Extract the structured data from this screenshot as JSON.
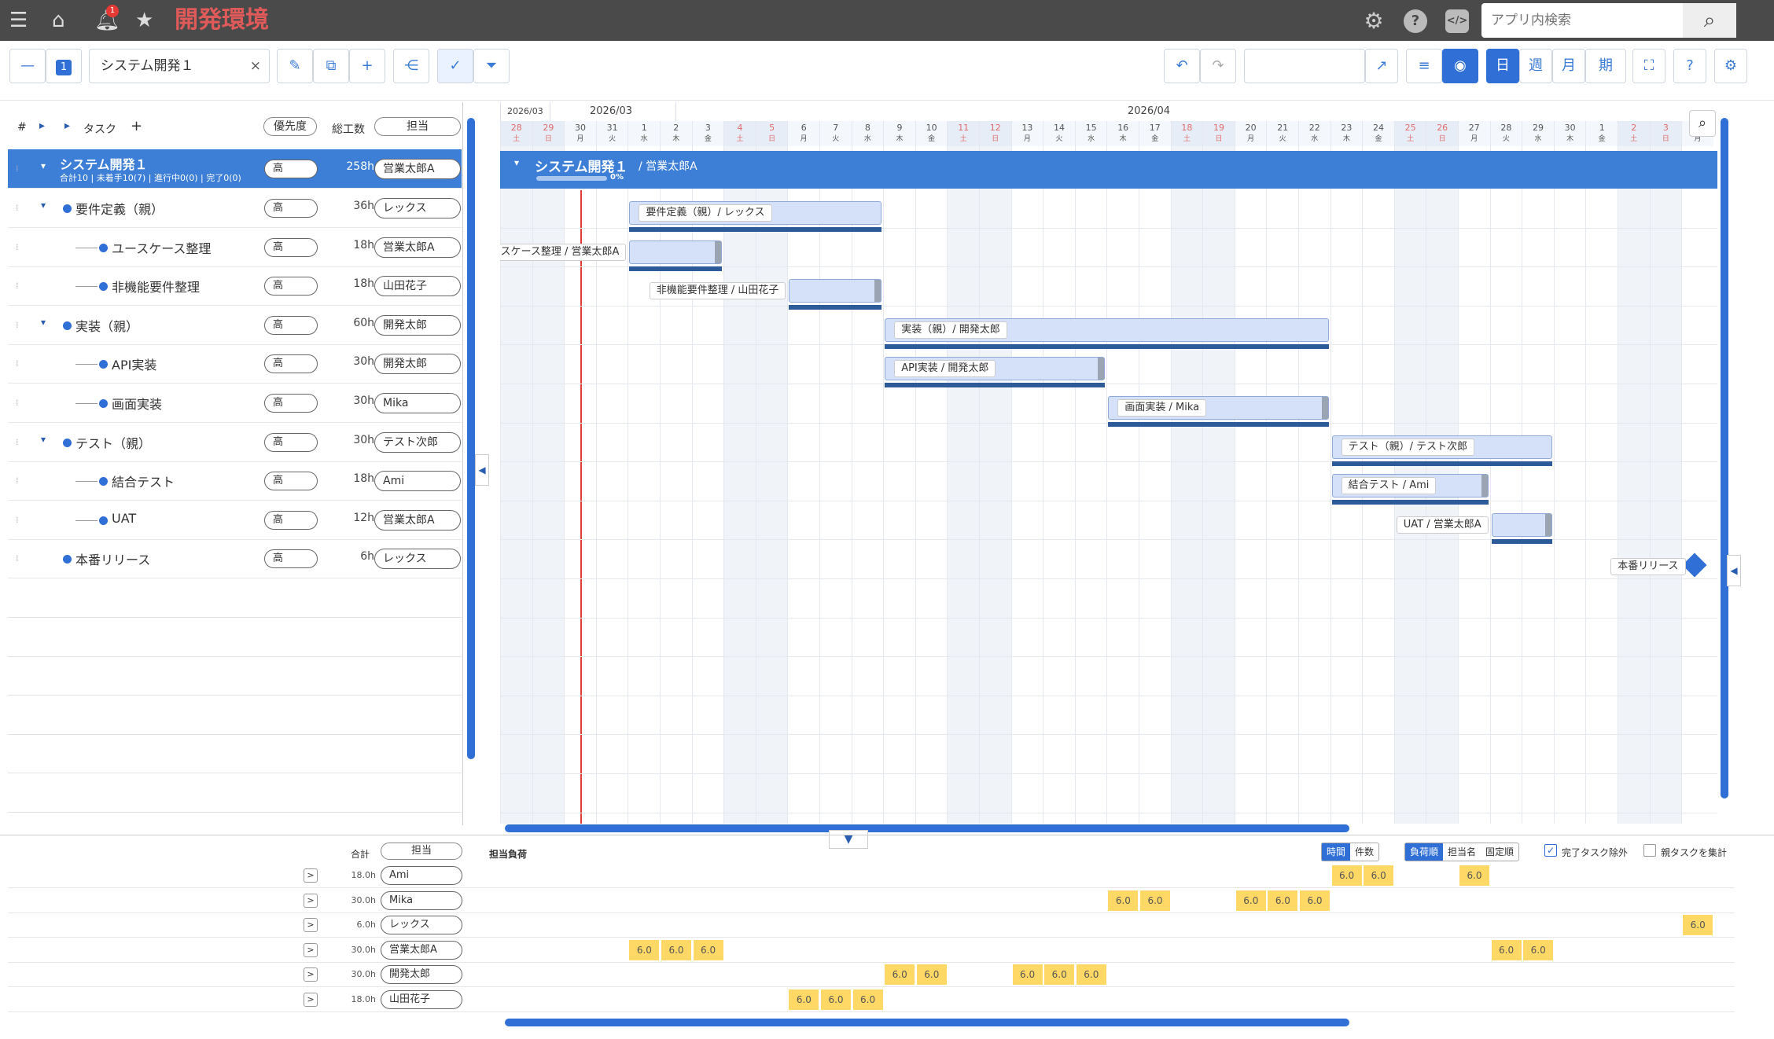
{
  "app": {
    "title": "開発環境",
    "notif_count": "1",
    "search_placeholder": "アプリ内検索"
  },
  "toolbar": {
    "layer_badge": "1",
    "project_name": "システム開発１",
    "clear": "×",
    "view_buttons": [
      "日",
      "週",
      "月",
      "期"
    ],
    "active_view": "日"
  },
  "grid": {
    "headers": {
      "num": "#",
      "task": "タスク",
      "add": "+",
      "priority": "優先度",
      "hours": "総工数",
      "assignee": "担当"
    },
    "project": {
      "name": "システム開発１",
      "summary": "合計10 | 未着手10(7) | 進行中0(0) | 完了0(0)",
      "priority": "高",
      "hours": "258h",
      "assignee": "営業太郎A"
    },
    "rows": [
      {
        "name": "要件定義（親）",
        "priority": "高",
        "hours": "36h",
        "assignee": "レックス"
      },
      {
        "name": "ユースケース整理",
        "priority": "高",
        "hours": "18h",
        "assignee": "営業太郎A"
      },
      {
        "name": "非機能要件整理",
        "priority": "高",
        "hours": "18h",
        "assignee": "山田花子"
      },
      {
        "name": "実装（親）",
        "priority": "高",
        "hours": "60h",
        "assignee": "開発太郎"
      },
      {
        "name": "API実装",
        "priority": "高",
        "hours": "30h",
        "assignee": "開発太郎"
      },
      {
        "name": "画面実装",
        "priority": "高",
        "hours": "30h",
        "assignee": "Mika"
      },
      {
        "name": "テスト（親）",
        "priority": "高",
        "hours": "30h",
        "assignee": "テスト次郎"
      },
      {
        "name": "結合テスト",
        "priority": "高",
        "hours": "18h",
        "assignee": "Ami"
      },
      {
        "name": "UAT",
        "priority": "高",
        "hours": "12h",
        "assignee": "営業太郎A"
      },
      {
        "name": "本番リリース",
        "priority": "高",
        "hours": "6h",
        "assignee": "レックス"
      }
    ]
  },
  "gantt": {
    "month_labels": [
      "2026/03",
      "2026/03",
      "2026/04"
    ],
    "days": [
      {
        "d": "28",
        "w": "土",
        "we": true
      },
      {
        "d": "29",
        "w": "日",
        "we": true
      },
      {
        "d": "30",
        "w": "月"
      },
      {
        "d": "31",
        "w": "火"
      },
      {
        "d": "1",
        "w": "水"
      },
      {
        "d": "2",
        "w": "木"
      },
      {
        "d": "3",
        "w": "金"
      },
      {
        "d": "4",
        "w": "土",
        "we": true
      },
      {
        "d": "5",
        "w": "日",
        "we": true
      },
      {
        "d": "6",
        "w": "月"
      },
      {
        "d": "7",
        "w": "火"
      },
      {
        "d": "8",
        "w": "水"
      },
      {
        "d": "9",
        "w": "木"
      },
      {
        "d": "10",
        "w": "金"
      },
      {
        "d": "11",
        "w": "土",
        "we": true
      },
      {
        "d": "12",
        "w": "日",
        "we": true
      },
      {
        "d": "13",
        "w": "月"
      },
      {
        "d": "14",
        "w": "火"
      },
      {
        "d": "15",
        "w": "水"
      },
      {
        "d": "16",
        "w": "木"
      },
      {
        "d": "17",
        "w": "金"
      },
      {
        "d": "18",
        "w": "土",
        "we": true
      },
      {
        "d": "19",
        "w": "日",
        "we": true
      },
      {
        "d": "20",
        "w": "月"
      },
      {
        "d": "21",
        "w": "火"
      },
      {
        "d": "22",
        "w": "水"
      },
      {
        "d": "23",
        "w": "木"
      },
      {
        "d": "24",
        "w": "金"
      },
      {
        "d": "25",
        "w": "土",
        "we": true
      },
      {
        "d": "26",
        "w": "日",
        "we": true
      },
      {
        "d": "27",
        "w": "月"
      },
      {
        "d": "28",
        "w": "火"
      },
      {
        "d": "29",
        "w": "水"
      },
      {
        "d": "30",
        "w": "木"
      },
      {
        "d": "1",
        "w": "金"
      },
      {
        "d": "2",
        "w": "土",
        "we": true
      },
      {
        "d": "3",
        "w": "日",
        "we": true
      },
      {
        "d": "4",
        "w": "月"
      }
    ],
    "project_bar": {
      "title": "システム開発１",
      "owner": "/ 営業太郎A",
      "progress": "0%"
    },
    "bar_labels": [
      "要件定義（親）/ レックス",
      "ユースケース整理 / 営業太郎A",
      "非機能要件整理 / 山田花子",
      "実装（親）/ 開発太郎",
      "API実装 / 開発太郎",
      "画面実装 / Mika",
      "テスト（親）/ テスト次郎",
      "結合テスト / Ami",
      "UAT / 営業太郎A",
      "本番リリース"
    ]
  },
  "load": {
    "headers": {
      "total": "合計",
      "assignee": "担当",
      "title": "担当負荷"
    },
    "toggles": [
      "時間",
      "件数"
    ],
    "sort": [
      "負荷順",
      "担当名",
      "固定順"
    ],
    "options": [
      {
        "label": "完了タスク除外",
        "checked": true
      },
      {
        "label": "親タスクを集計",
        "checked": false
      }
    ],
    "rows": [
      {
        "assignee": "Ami",
        "total": "18.0h",
        "cells": [
          [
            26,
            "6.0"
          ],
          [
            27,
            "6.0"
          ],
          [
            30,
            "6.0"
          ]
        ]
      },
      {
        "assignee": "Mika",
        "total": "30.0h",
        "cells": [
          [
            19,
            "6.0"
          ],
          [
            20,
            "6.0"
          ],
          [
            23,
            "6.0"
          ],
          [
            24,
            "6.0"
          ],
          [
            25,
            "6.0"
          ]
        ]
      },
      {
        "assignee": "レックス",
        "total": "6.0h",
        "cells": [
          [
            37,
            "6.0"
          ]
        ]
      },
      {
        "assignee": "営業太郎A",
        "total": "30.0h",
        "cells": [
          [
            4,
            "6.0"
          ],
          [
            5,
            "6.0"
          ],
          [
            6,
            "6.0"
          ],
          [
            31,
            "6.0"
          ],
          [
            32,
            "6.0"
          ]
        ]
      },
      {
        "assignee": "開発太郎",
        "total": "30.0h",
        "cells": [
          [
            12,
            "6.0"
          ],
          [
            13,
            "6.0"
          ],
          [
            16,
            "6.0"
          ],
          [
            17,
            "6.0"
          ],
          [
            18,
            "6.0"
          ]
        ]
      },
      {
        "assignee": "山田花子",
        "total": "18.0h",
        "cells": [
          [
            9,
            "6.0"
          ],
          [
            10,
            "6.0"
          ],
          [
            11,
            "6.0"
          ]
        ]
      }
    ]
  }
}
